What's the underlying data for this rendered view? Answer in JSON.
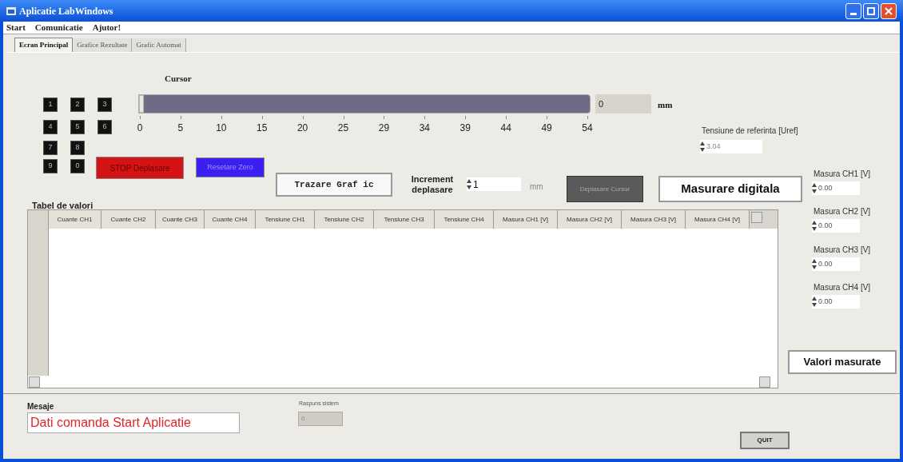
{
  "window": {
    "title": "Aplicatie LabWindows"
  },
  "menu": [
    "Start",
    "Comunicatie",
    "Ajutor!"
  ],
  "tabs": [
    {
      "label": "Ecran Principal",
      "selected": true
    },
    {
      "label": "Grafice Rezultate",
      "selected": false
    },
    {
      "label": "Grafic Automat",
      "selected": false
    }
  ],
  "keypad": [
    "1",
    "2",
    "3",
    "4",
    "5",
    "6",
    "7",
    "8",
    "9",
    "0"
  ],
  "cursor": {
    "label": "Cursor",
    "level": 0,
    "ticks": [
      "0",
      "5",
      "10",
      "15",
      "20",
      "25",
      "29",
      "34",
      "39",
      "44",
      "49",
      "54"
    ],
    "reading": "0",
    "unit": "mm"
  },
  "buttons": {
    "stop": "STOP Deplasare",
    "reset": "Resetare Zero",
    "plot": "Trazare Graf ic",
    "move": "Deplasare Cursor",
    "digital": "Masurare digitala",
    "measured": "Valori masurate",
    "quit": "QUIT"
  },
  "reference": {
    "label": "Tensiune de referinta [Uref]",
    "value": "3.04"
  },
  "increment": {
    "label": "Increment deplasare",
    "value": "1",
    "unit": "mm"
  },
  "measurements": [
    {
      "label": "Masura CH1 [V]",
      "value": "0.00"
    },
    {
      "label": "Masura CH2 [V]",
      "value": "0.00"
    },
    {
      "label": "Masura CH3 [V]",
      "value": "0.00"
    },
    {
      "label": "Masura CH4 [V]",
      "value": "0.00"
    }
  ],
  "table": {
    "title": "Tabel de valori",
    "columns": [
      "Cuante CH1",
      "Cuante CH2",
      "Cuante CH3",
      "Cuante CH4",
      "Tensiune CH1",
      "Tensiune CH2",
      "Tensiune CH3",
      "Tensiune CH4",
      "Masura CH1 [V]",
      "Masura CH2 [V]",
      "Masura CH3 [V]",
      "Masura CH4 [V]"
    ]
  },
  "messages": {
    "label": "Mesaje",
    "value": "Dati comanda Start Aplicatie"
  },
  "response": {
    "label": "Raspuns sistem",
    "value": "0"
  }
}
